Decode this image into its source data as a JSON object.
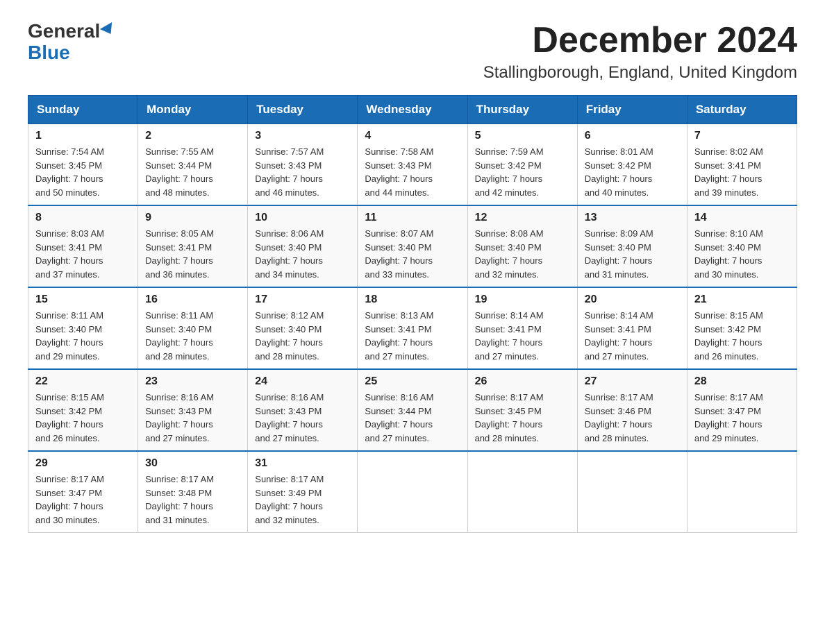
{
  "logo": {
    "line1": "General",
    "line2": "Blue"
  },
  "title": "December 2024",
  "subtitle": "Stallingborough, England, United Kingdom",
  "headers": [
    "Sunday",
    "Monday",
    "Tuesday",
    "Wednesday",
    "Thursday",
    "Friday",
    "Saturday"
  ],
  "weeks": [
    [
      {
        "day": "1",
        "sunrise": "7:54 AM",
        "sunset": "3:45 PM",
        "daylight": "7 hours and 50 minutes."
      },
      {
        "day": "2",
        "sunrise": "7:55 AM",
        "sunset": "3:44 PM",
        "daylight": "7 hours and 48 minutes."
      },
      {
        "day": "3",
        "sunrise": "7:57 AM",
        "sunset": "3:43 PM",
        "daylight": "7 hours and 46 minutes."
      },
      {
        "day": "4",
        "sunrise": "7:58 AM",
        "sunset": "3:43 PM",
        "daylight": "7 hours and 44 minutes."
      },
      {
        "day": "5",
        "sunrise": "7:59 AM",
        "sunset": "3:42 PM",
        "daylight": "7 hours and 42 minutes."
      },
      {
        "day": "6",
        "sunrise": "8:01 AM",
        "sunset": "3:42 PM",
        "daylight": "7 hours and 40 minutes."
      },
      {
        "day": "7",
        "sunrise": "8:02 AM",
        "sunset": "3:41 PM",
        "daylight": "7 hours and 39 minutes."
      }
    ],
    [
      {
        "day": "8",
        "sunrise": "8:03 AM",
        "sunset": "3:41 PM",
        "daylight": "7 hours and 37 minutes."
      },
      {
        "day": "9",
        "sunrise": "8:05 AM",
        "sunset": "3:41 PM",
        "daylight": "7 hours and 36 minutes."
      },
      {
        "day": "10",
        "sunrise": "8:06 AM",
        "sunset": "3:40 PM",
        "daylight": "7 hours and 34 minutes."
      },
      {
        "day": "11",
        "sunrise": "8:07 AM",
        "sunset": "3:40 PM",
        "daylight": "7 hours and 33 minutes."
      },
      {
        "day": "12",
        "sunrise": "8:08 AM",
        "sunset": "3:40 PM",
        "daylight": "7 hours and 32 minutes."
      },
      {
        "day": "13",
        "sunrise": "8:09 AM",
        "sunset": "3:40 PM",
        "daylight": "7 hours and 31 minutes."
      },
      {
        "day": "14",
        "sunrise": "8:10 AM",
        "sunset": "3:40 PM",
        "daylight": "7 hours and 30 minutes."
      }
    ],
    [
      {
        "day": "15",
        "sunrise": "8:11 AM",
        "sunset": "3:40 PM",
        "daylight": "7 hours and 29 minutes."
      },
      {
        "day": "16",
        "sunrise": "8:11 AM",
        "sunset": "3:40 PM",
        "daylight": "7 hours and 28 minutes."
      },
      {
        "day": "17",
        "sunrise": "8:12 AM",
        "sunset": "3:40 PM",
        "daylight": "7 hours and 28 minutes."
      },
      {
        "day": "18",
        "sunrise": "8:13 AM",
        "sunset": "3:41 PM",
        "daylight": "7 hours and 27 minutes."
      },
      {
        "day": "19",
        "sunrise": "8:14 AM",
        "sunset": "3:41 PM",
        "daylight": "7 hours and 27 minutes."
      },
      {
        "day": "20",
        "sunrise": "8:14 AM",
        "sunset": "3:41 PM",
        "daylight": "7 hours and 27 minutes."
      },
      {
        "day": "21",
        "sunrise": "8:15 AM",
        "sunset": "3:42 PM",
        "daylight": "7 hours and 26 minutes."
      }
    ],
    [
      {
        "day": "22",
        "sunrise": "8:15 AM",
        "sunset": "3:42 PM",
        "daylight": "7 hours and 26 minutes."
      },
      {
        "day": "23",
        "sunrise": "8:16 AM",
        "sunset": "3:43 PM",
        "daylight": "7 hours and 27 minutes."
      },
      {
        "day": "24",
        "sunrise": "8:16 AM",
        "sunset": "3:43 PM",
        "daylight": "7 hours and 27 minutes."
      },
      {
        "day": "25",
        "sunrise": "8:16 AM",
        "sunset": "3:44 PM",
        "daylight": "7 hours and 27 minutes."
      },
      {
        "day": "26",
        "sunrise": "8:17 AM",
        "sunset": "3:45 PM",
        "daylight": "7 hours and 28 minutes."
      },
      {
        "day": "27",
        "sunrise": "8:17 AM",
        "sunset": "3:46 PM",
        "daylight": "7 hours and 28 minutes."
      },
      {
        "day": "28",
        "sunrise": "8:17 AM",
        "sunset": "3:47 PM",
        "daylight": "7 hours and 29 minutes."
      }
    ],
    [
      {
        "day": "29",
        "sunrise": "8:17 AM",
        "sunset": "3:47 PM",
        "daylight": "7 hours and 30 minutes."
      },
      {
        "day": "30",
        "sunrise": "8:17 AM",
        "sunset": "3:48 PM",
        "daylight": "7 hours and 31 minutes."
      },
      {
        "day": "31",
        "sunrise": "8:17 AM",
        "sunset": "3:49 PM",
        "daylight": "7 hours and 32 minutes."
      },
      null,
      null,
      null,
      null
    ]
  ],
  "labels": {
    "sunrise": "Sunrise:",
    "sunset": "Sunset:",
    "daylight": "Daylight:"
  }
}
